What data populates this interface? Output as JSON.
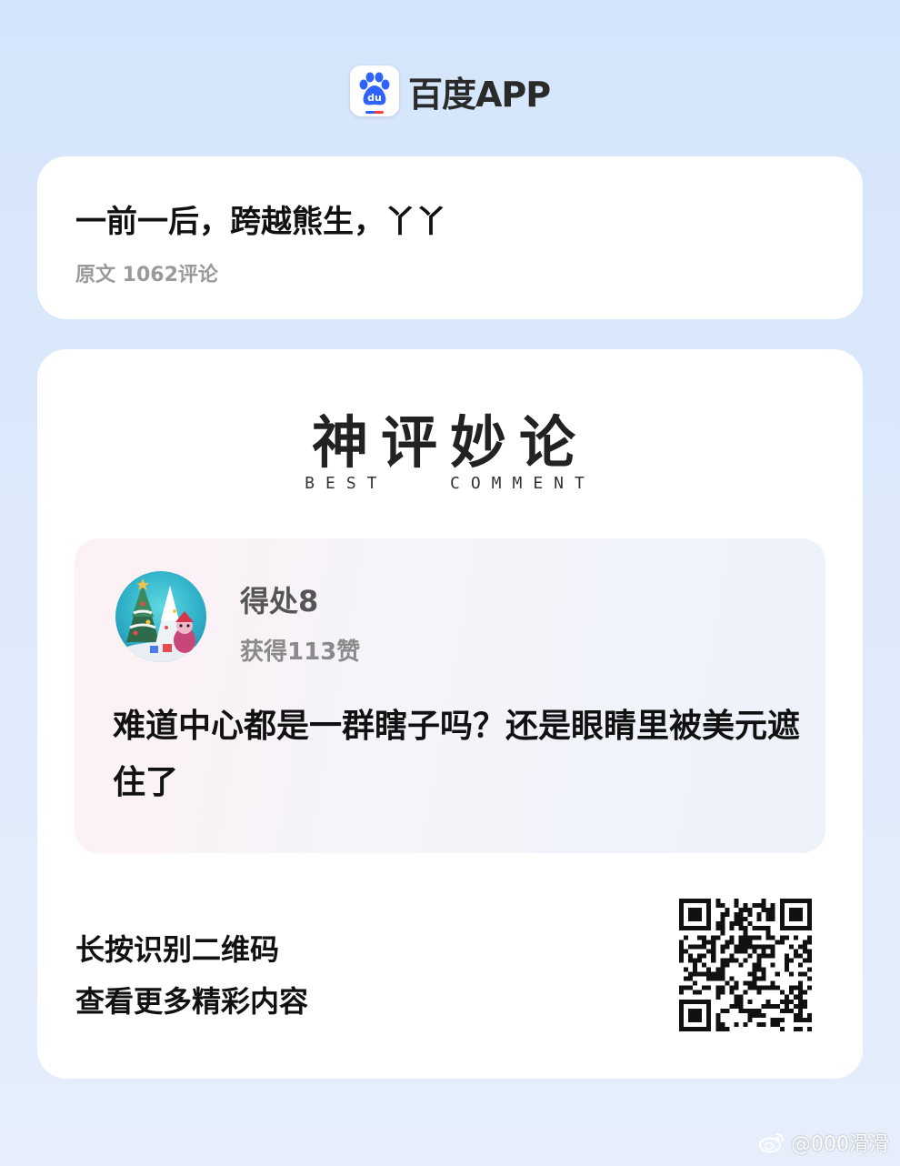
{
  "header": {
    "app_name": "百度APP",
    "logo_icon": "baidu-paw-icon",
    "logo_text": "du"
  },
  "post": {
    "title": "一前一后，跨越熊生，丫丫",
    "meta": "原文 1062评论"
  },
  "best_comment": {
    "title": "神评妙论",
    "subtitle": "BEST   COMMENT",
    "user": {
      "name": "得处8",
      "likes": "获得113赞",
      "avatar_icon": "christmas-tree-avatar"
    },
    "text": "难道中心都是一群瞎子吗？还是眼睛里被美元遮住了"
  },
  "qr": {
    "line1": "长按识别二维码",
    "line2": "查看更多精彩内容",
    "icon": "qr-code-icon"
  },
  "watermark": {
    "text": "@000滑滑",
    "icon": "weibo-icon"
  },
  "colors": {
    "background": "#d4e5fb",
    "card": "#ffffff",
    "meta_gray": "#9a9a9a",
    "baidu_blue": "#2f63ff",
    "baidu_red": "#ff3b3b"
  }
}
